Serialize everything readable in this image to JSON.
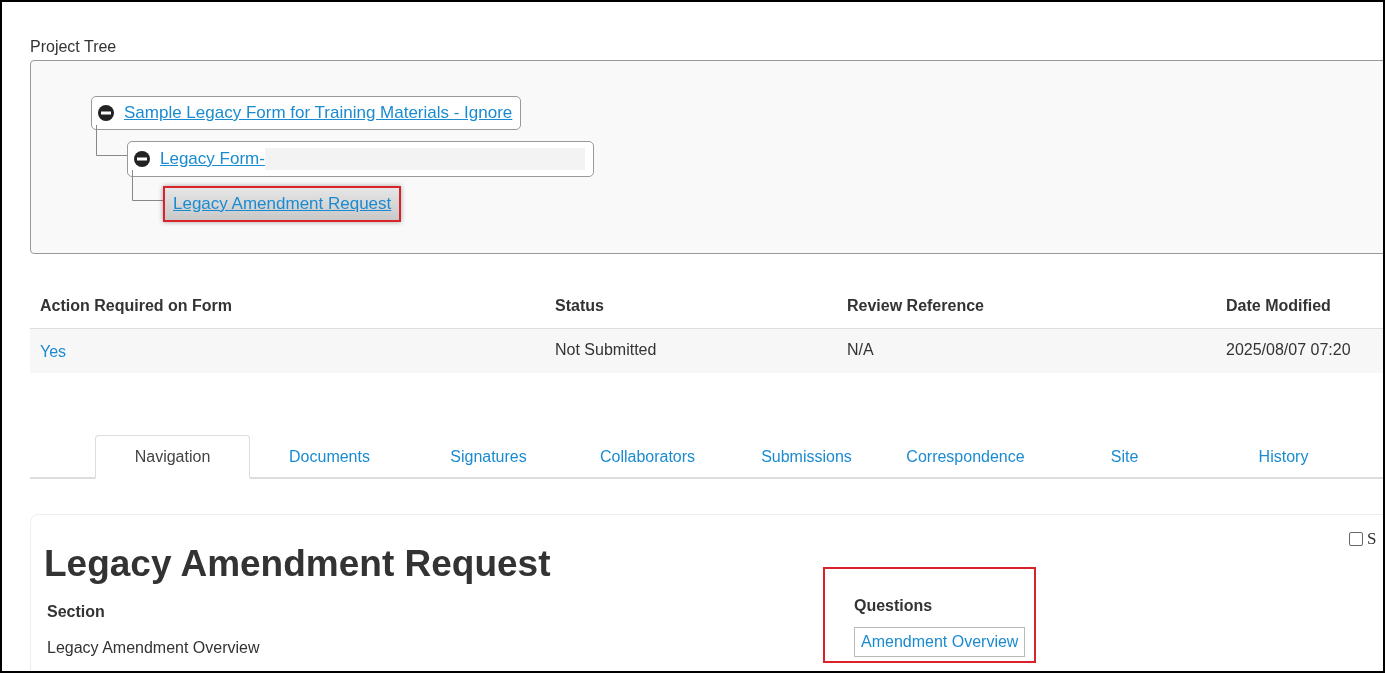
{
  "project_tree": {
    "label": "Project Tree",
    "nodes": [
      {
        "label": "Sample Legacy Form for Training Materials - Ignore",
        "expanded": true,
        "selected": false,
        "highlighted": false,
        "children": [
          {
            "label": "Legacy Form-",
            "expanded": true,
            "selected": false,
            "highlighted": false,
            "redacted": true,
            "children": [
              {
                "label": "Legacy Amendment Request",
                "expanded": false,
                "selected": true,
                "highlighted": true
              }
            ]
          }
        ]
      }
    ]
  },
  "table": {
    "columns": [
      "Action Required on Form",
      "Status",
      "Review Reference",
      "Date Modified"
    ],
    "rows": [
      {
        "cells": [
          "Yes",
          "Not Submitted",
          "N/A",
          "2025/08/07 07:20"
        ]
      }
    ]
  },
  "tabs": [
    {
      "label": "Navigation",
      "selected": true
    },
    {
      "label": "Documents",
      "selected": false
    },
    {
      "label": "Signatures",
      "selected": false
    },
    {
      "label": "Collaborators",
      "selected": false
    },
    {
      "label": "Submissions",
      "selected": false
    },
    {
      "label": "Correspondence",
      "selected": false
    },
    {
      "label": "Site",
      "selected": false
    },
    {
      "label": "History",
      "selected": false
    }
  ],
  "panel": {
    "title": "Legacy Amendment Request",
    "checkbox": {
      "label": "S",
      "checked": false
    },
    "section_heading": "Section",
    "sections": [
      "Legacy Amendment Overview"
    ],
    "questions_heading": "Questions",
    "questions_highlighted": true,
    "questions": [
      "Amendment Overview"
    ]
  }
}
